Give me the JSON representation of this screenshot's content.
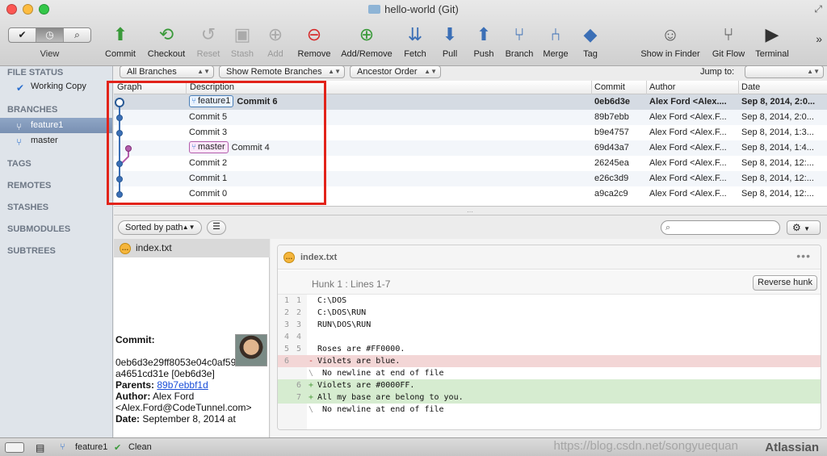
{
  "window": {
    "title": "hello-world (Git)"
  },
  "toolbar": {
    "view_label": "View",
    "view_segments": [
      "✔",
      "◷",
      "⌕"
    ],
    "buttons": [
      {
        "label": "Commit",
        "icon": "commit-icon",
        "glyph": "⬆",
        "color": "#3a9a3a",
        "enabled": true
      },
      {
        "label": "Checkout",
        "icon": "checkout-icon",
        "glyph": "⟲",
        "color": "#3a9a3a",
        "enabled": true
      },
      {
        "label": "Reset",
        "icon": "reset-icon",
        "glyph": "↺",
        "color": "#aaaaaa",
        "enabled": false
      },
      {
        "label": "Stash",
        "icon": "stash-icon",
        "glyph": "▣",
        "color": "#aaaaaa",
        "enabled": false
      },
      {
        "label": "Add",
        "icon": "add-icon",
        "glyph": "⊕",
        "color": "#aaaaaa",
        "enabled": false
      },
      {
        "label": "Remove",
        "icon": "remove-icon",
        "glyph": "⊖",
        "color": "#d62c2c",
        "enabled": true
      },
      {
        "label": "Add/Remove",
        "icon": "add-remove-icon",
        "glyph": "⊕",
        "color": "#3a9a3a",
        "enabled": true
      },
      {
        "label": "Fetch",
        "icon": "fetch-icon",
        "glyph": "⇊",
        "color": "#3b6fb6",
        "enabled": true
      },
      {
        "label": "Pull",
        "icon": "pull-icon",
        "glyph": "⬇",
        "color": "#3b6fb6",
        "enabled": true
      },
      {
        "label": "Push",
        "icon": "push-icon",
        "glyph": "⬆",
        "color": "#3b6fb6",
        "enabled": true
      },
      {
        "label": "Branch",
        "icon": "branch-icon",
        "glyph": "⑂",
        "color": "#3b6fb6",
        "enabled": true
      },
      {
        "label": "Merge",
        "icon": "merge-icon",
        "glyph": "⑃",
        "color": "#3b6fb6",
        "enabled": true
      },
      {
        "label": "Tag",
        "icon": "tag-icon",
        "glyph": "◆",
        "color": "#3b6fb6",
        "enabled": true
      },
      {
        "label": "Show in Finder",
        "icon": "finder-icon",
        "glyph": "☺",
        "color": "#555555",
        "enabled": true
      },
      {
        "label": "Git Flow",
        "icon": "git-flow-icon",
        "glyph": "⑂",
        "color": "#555555",
        "enabled": true
      },
      {
        "label": "Terminal",
        "icon": "terminal-icon",
        "glyph": "▶",
        "color": "#333333",
        "enabled": true
      }
    ]
  },
  "sidebar": {
    "sections": {
      "file_status": "FILE STATUS",
      "working_copy": "Working Copy",
      "branches": "BRANCHES",
      "tags": "TAGS",
      "remotes": "REMOTES",
      "stashes": "STASHES",
      "submodules": "SUBMODULES",
      "subtrees": "SUBTREES"
    },
    "branches": [
      {
        "label": "feature1",
        "selected": true
      },
      {
        "label": "master",
        "selected": false
      }
    ]
  },
  "filters": {
    "branches": "All Branches",
    "remote": "Show Remote Branches",
    "order": "Ancestor Order",
    "jump_to": "Jump to:"
  },
  "history": {
    "columns": {
      "graph": "Graph",
      "description": "Description",
      "commit": "Commit",
      "author": "Author",
      "date": "Date"
    },
    "rows": [
      {
        "tag": "feature1",
        "tag_type": "feature",
        "desc": "Commit 6",
        "commit": "0eb6d3e",
        "author": "Alex Ford <Alex....",
        "date": "Sep 8, 2014, 2:0...",
        "bold": true
      },
      {
        "tag": "",
        "tag_type": "",
        "desc": "Commit 5",
        "commit": "89b7ebb",
        "author": "Alex Ford <Alex.F...",
        "date": "Sep 8, 2014, 2:0...",
        "bold": false
      },
      {
        "tag": "",
        "tag_type": "",
        "desc": "Commit 3",
        "commit": "b9e4757",
        "author": "Alex Ford <Alex.F...",
        "date": "Sep 8, 2014, 1:3...",
        "bold": false
      },
      {
        "tag": "master",
        "tag_type": "master",
        "desc": "Commit 4",
        "commit": "69d43a7",
        "author": "Alex Ford <Alex.F...",
        "date": "Sep 8, 2014, 1:4...",
        "bold": false
      },
      {
        "tag": "",
        "tag_type": "",
        "desc": "Commit 2",
        "commit": "26245ea",
        "author": "Alex Ford <Alex.F...",
        "date": "Sep 8, 2014, 12:...",
        "bold": false
      },
      {
        "tag": "",
        "tag_type": "",
        "desc": "Commit 1",
        "commit": "e26c3d9",
        "author": "Alex Ford <Alex.F...",
        "date": "Sep 8, 2014, 12:...",
        "bold": false
      },
      {
        "tag": "",
        "tag_type": "",
        "desc": "Commit 0",
        "commit": "a9ca2c9",
        "author": "Alex Ford <Alex.F...",
        "date": "Sep 8, 2014, 12:...",
        "bold": false
      }
    ]
  },
  "bottom": {
    "sort_label": "Sorted by path",
    "files": [
      "index.txt"
    ],
    "commit_info": {
      "commit_label": "Commit:",
      "hash": "0eb6d3e29ff8053e04c0af598c5f23a4651cd31e [0eb6d3e]",
      "parents_label": "Parents:",
      "parent": "89b7ebbf1d",
      "author_label": "Author:",
      "author": "Alex Ford <Alex.Ford@CodeTunnel.com>",
      "date_label": "Date:",
      "date": "September 8, 2014 at"
    }
  },
  "diff": {
    "file": "index.txt",
    "more": "•••",
    "hunk_label": "Hunk 1 : Lines 1-7",
    "reverse_label": "Reverse hunk",
    "lines": [
      {
        "n1": "1",
        "n2": "1",
        "mk": "",
        "type": "ctx",
        "text": "C:\\DOS"
      },
      {
        "n1": "2",
        "n2": "2",
        "mk": "",
        "type": "ctx",
        "text": "C:\\DOS\\RUN"
      },
      {
        "n1": "3",
        "n2": "3",
        "mk": "",
        "type": "ctx",
        "text": "RUN\\DOS\\RUN"
      },
      {
        "n1": "4",
        "n2": "4",
        "mk": "",
        "type": "ctx",
        "text": ""
      },
      {
        "n1": "5",
        "n2": "5",
        "mk": "",
        "type": "ctx",
        "text": "Roses are #FF0000."
      },
      {
        "n1": "6",
        "n2": "",
        "mk": "-",
        "type": "del",
        "text": "Violets are blue."
      },
      {
        "n1": "",
        "n2": "",
        "mk": "\\",
        "type": "ctx",
        "text": " No newline at end of file"
      },
      {
        "n1": "",
        "n2": "6",
        "mk": "+",
        "type": "add",
        "text": "Violets are #0000FF."
      },
      {
        "n1": "",
        "n2": "7",
        "mk": "+",
        "type": "add",
        "text": "All my base are belong to you."
      },
      {
        "n1": "",
        "n2": "",
        "mk": "\\",
        "type": "ctx",
        "text": " No newline at end of file"
      }
    ]
  },
  "statusbar": {
    "branch": "feature1",
    "state": "Clean",
    "brand": "Atlassian"
  },
  "watermark": "https://blog.csdn.net/songyuequan"
}
